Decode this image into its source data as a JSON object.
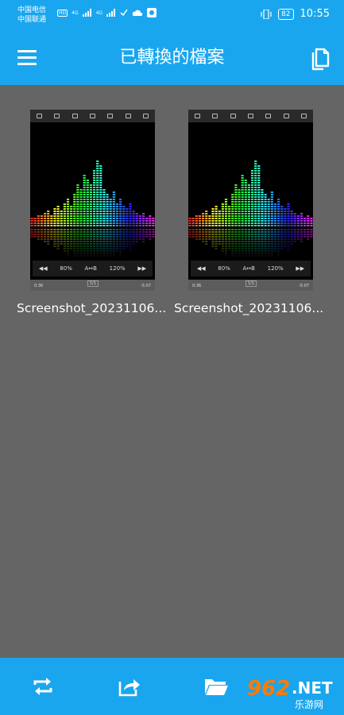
{
  "status_bar": {
    "carrier_1": "中国电信",
    "carrier_2": "中国联通",
    "hd_label": "HD",
    "net_1": "4G",
    "net_2": "4G",
    "battery": "82",
    "time": "10:55"
  },
  "app_bar": {
    "title": "已轉換的檔案",
    "menu_icon": "hamburger-menu-icon",
    "action_icon": "copy-files-icon"
  },
  "files": [
    {
      "name": "Screenshot_20231106...",
      "thumb": {
        "speed_left": "80%",
        "ab": "A↔B",
        "speed_right": "120%",
        "time_start": "0:36",
        "track": "1/1",
        "time_end": "-5:07"
      }
    },
    {
      "name": "Screenshot_20231106...",
      "thumb": {
        "speed_left": "80%",
        "ab": "A↔B",
        "speed_right": "120%",
        "time_start": "0:36",
        "track": "1/1",
        "time_end": "-5:07"
      }
    }
  ],
  "bottom_bar": {
    "buttons": [
      {
        "icon": "convert-repeat-icon"
      },
      {
        "icon": "share-icon"
      },
      {
        "icon": "folder-icon"
      }
    ]
  },
  "watermark": {
    "number": "962",
    "suffix": ".NET",
    "text": "乐游网"
  },
  "colors": {
    "primary": "#1aa6ee",
    "background": "#656565"
  }
}
